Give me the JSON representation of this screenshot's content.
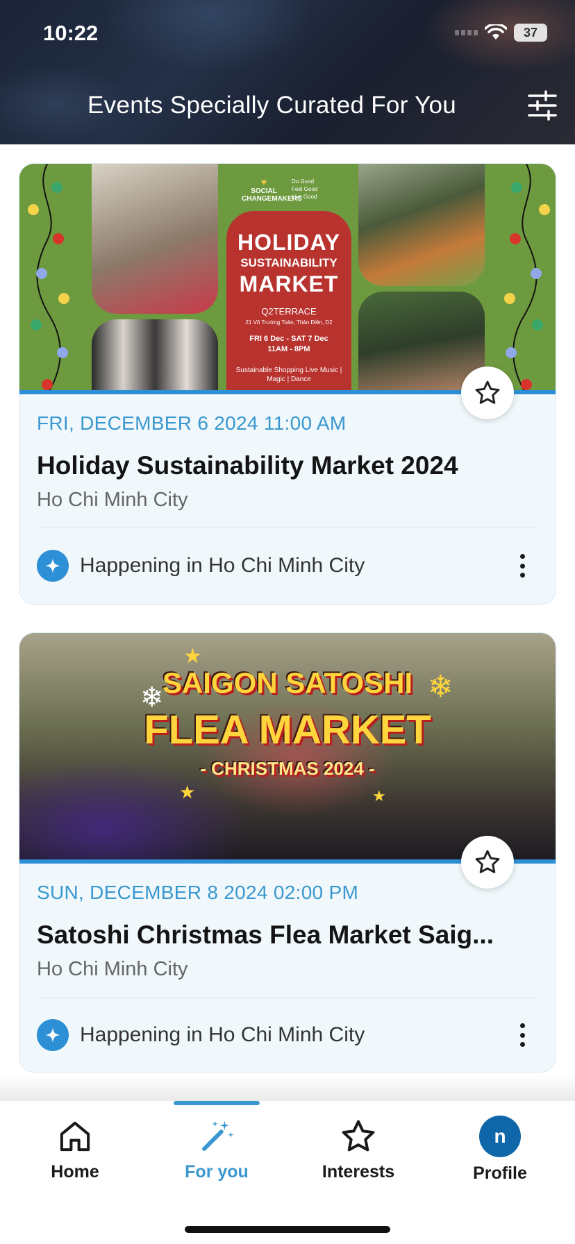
{
  "status_bar": {
    "time": "10:22",
    "battery": "37"
  },
  "header": {
    "title": "Events Specially Curated For You",
    "filter_icon": "sliders-icon"
  },
  "events": [
    {
      "date": "FRI, DECEMBER 6 2024 11:00 AM",
      "title": "Holiday Sustainability Market 2024",
      "city": "Ho Chi Minh City",
      "footer": "Happening in Ho Chi Minh City",
      "poster": {
        "brand": "SOCIAL CHANGEMAKERS",
        "tagline": "Do Good Feel Good Live Good",
        "headline1": "HOLIDAY",
        "headline2": "SUSTAINABILITY",
        "headline3": "MARKET",
        "venue": "Q2TERRACE",
        "address": "21 Võ Trường Toản, Thảo Điền, D2",
        "dates": "FRI 6 Dec - SAT 7 Dec",
        "hours": "11AM - 8PM",
        "features": "Sustainable Shopping Live Music | Magic | Dance"
      }
    },
    {
      "date": "SUN, DECEMBER 8 2024 02:00 PM",
      "title": "Satoshi Christmas Flea Market Saig...",
      "city": "Ho Chi Minh City",
      "footer": "Happening in Ho Chi Minh City",
      "poster": {
        "line1": "SAIGON SATOSHI",
        "line2": "FLEA MARKET",
        "line3": "- CHRISTMAS 2024 -"
      }
    }
  ],
  "nav": {
    "home": "Home",
    "for_you": "For you",
    "interests": "Interests",
    "profile": "Profile",
    "avatar_initial": "n",
    "active": "for_you"
  },
  "colors": {
    "accent": "#3a97cf",
    "avatar": "#0f66a8",
    "card_bg": "#f0f8fc"
  }
}
